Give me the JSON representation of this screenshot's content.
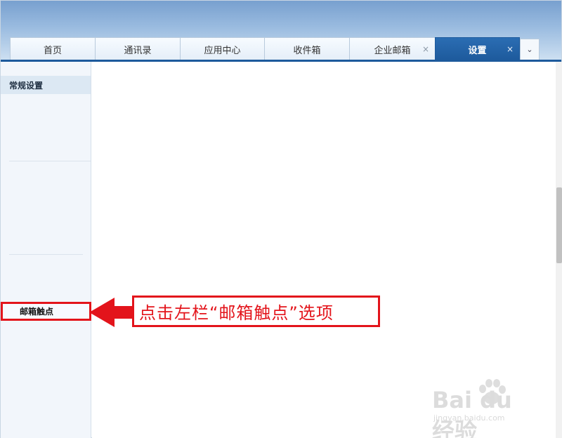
{
  "tabs": [
    {
      "label": "首页",
      "closable": false,
      "active": false
    },
    {
      "label": "通讯录",
      "closable": false,
      "active": false
    },
    {
      "label": "应用中心",
      "closable": false,
      "active": false
    },
    {
      "label": "收件箱",
      "closable": false,
      "active": false
    },
    {
      "label": "企业邮箱",
      "closable": true,
      "active": false
    },
    {
      "label": "设置",
      "closable": true,
      "active": true
    }
  ],
  "tab_close_glyph": "×",
  "more_glyph": "⌄",
  "sidebar": {
    "section_title": "常规设置",
    "highlighted_item": "邮箱触点"
  },
  "annotation": {
    "text": "点击左栏“邮箱触点”选项",
    "color": "#e3141b"
  },
  "watermark": {
    "brand": "Bai du 经验",
    "url": "jingyan.baidu.com"
  },
  "colors": {
    "accent": "#1d5a9c",
    "header_top": "#78a0cf",
    "highlight": "#e3141b"
  }
}
